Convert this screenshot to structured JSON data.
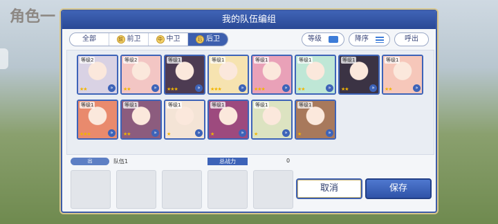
{
  "background": {
    "title": "角色一"
  },
  "dialog": {
    "title": "我的队伍编组",
    "tabs": [
      {
        "label": "全部",
        "icon": ""
      },
      {
        "label": "前卫",
        "icon": "前"
      },
      {
        "label": "中卫",
        "icon": "中"
      },
      {
        "label": "后卫",
        "icon": "后"
      }
    ],
    "filters": {
      "level": "等级",
      "order": "降序",
      "summon": "呼出"
    }
  },
  "characters": [
    {
      "level": "等级2",
      "stars": "★★",
      "color": "#d9d2e4"
    },
    {
      "level": "等级2",
      "stars": "★★",
      "color": "#f3c6c4"
    },
    {
      "level": "等级1",
      "stars": "★★★",
      "color": "#4d3b52"
    },
    {
      "level": "等级1",
      "stars": "★★★",
      "color": "#f6e3b0"
    },
    {
      "level": "等级1",
      "stars": "★★★",
      "color": "#e9a1b8"
    },
    {
      "level": "等级1",
      "stars": "★★",
      "color": "#bfe7d6"
    },
    {
      "level": "等级1",
      "stars": "★★",
      "color": "#3b3344"
    },
    {
      "level": "等级1",
      "stars": "★★",
      "color": "#f6c7ba"
    },
    {
      "level": "等级1",
      "stars": "★★★",
      "color": "#e98a6d"
    },
    {
      "level": "等级1",
      "stars": "★★",
      "color": "#8c5c7e"
    },
    {
      "level": "等级1",
      "stars": "★",
      "color": "#f4e4d6"
    },
    {
      "level": "等级1",
      "stars": "★",
      "color": "#9d4a7e"
    },
    {
      "level": "等级1",
      "stars": "★",
      "color": "#dce3c1"
    },
    {
      "level": "等级1",
      "stars": "★",
      "color": "#a8795c"
    }
  ],
  "team": {
    "tag": "出",
    "name": "队伍1",
    "power_label": "总战力",
    "power_value": "0"
  },
  "buttons": {
    "cancel": "取消",
    "save": "保存"
  }
}
